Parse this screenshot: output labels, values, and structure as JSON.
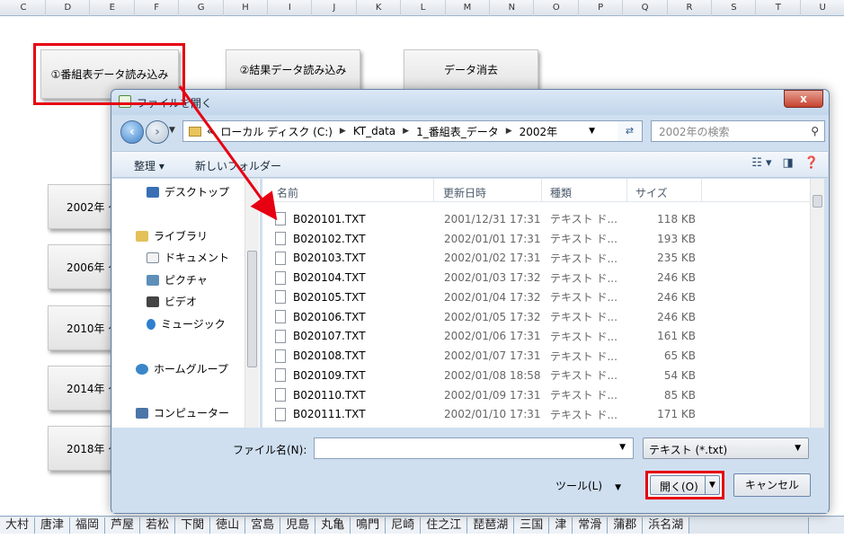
{
  "spreadsheet": {
    "columns": [
      "C",
      "D",
      "E",
      "F",
      "G",
      "H",
      "I",
      "J",
      "K",
      "L",
      "M",
      "N",
      "O",
      "P",
      "Q",
      "R",
      "S",
      "T",
      "U"
    ],
    "top_buttons": {
      "load_schedule": "①番組表データ読み込み",
      "load_results": "②結果データ読み込み",
      "clear_data": "データ消去"
    },
    "year_buttons": [
      "2002年 ～",
      "2006年 ～",
      "2010年 ～",
      "2014年 ～",
      "2018年 ～"
    ],
    "sheet_tabs": [
      "大村",
      "唐津",
      "福岡",
      "芦屋",
      "若松",
      "下関",
      "徳山",
      "宮島",
      "児島",
      "丸亀",
      "鳴門",
      "尼崎",
      "住之江",
      "琵琶湖",
      "三国",
      "津",
      "常滑",
      "蒲郡",
      "浜名湖"
    ]
  },
  "dialog": {
    "title": "ファイルを開く",
    "close_label": "x",
    "address": {
      "prefix": "«",
      "crumbs": [
        "ローカル ディスク (C:)",
        "KT_data",
        "1_番組表_データ",
        "2002年"
      ]
    },
    "search_placeholder": "2002年の検索",
    "toolbar": {
      "organize": "整理 ▾",
      "new_folder": "新しいフォルダー"
    },
    "nav": [
      "デスクトップ",
      "ライブラリ",
      "ドキュメント",
      "ピクチャ",
      "ビデオ",
      "ミュージック",
      "ホームグループ",
      "コンピューター"
    ],
    "columns": {
      "name": "名前",
      "date": "更新日時",
      "type": "種類",
      "size": "サイズ"
    },
    "files": [
      {
        "name": "B020101.TXT",
        "date": "2001/12/31 17:31",
        "type": "テキスト ド...",
        "size": "118 KB"
      },
      {
        "name": "B020102.TXT",
        "date": "2002/01/01 17:31",
        "type": "テキスト ド...",
        "size": "193 KB"
      },
      {
        "name": "B020103.TXT",
        "date": "2002/01/02 17:31",
        "type": "テキスト ド...",
        "size": "235 KB"
      },
      {
        "name": "B020104.TXT",
        "date": "2002/01/03 17:32",
        "type": "テキスト ド...",
        "size": "246 KB"
      },
      {
        "name": "B020105.TXT",
        "date": "2002/01/04 17:32",
        "type": "テキスト ド...",
        "size": "246 KB"
      },
      {
        "name": "B020106.TXT",
        "date": "2002/01/05 17:32",
        "type": "テキスト ド...",
        "size": "246 KB"
      },
      {
        "name": "B020107.TXT",
        "date": "2002/01/06 17:31",
        "type": "テキスト ド...",
        "size": "161 KB"
      },
      {
        "name": "B020108.TXT",
        "date": "2002/01/07 17:31",
        "type": "テキスト ド...",
        "size": "65 KB"
      },
      {
        "name": "B020109.TXT",
        "date": "2002/01/08 18:58",
        "type": "テキスト ド...",
        "size": "54 KB"
      },
      {
        "name": "B020110.TXT",
        "date": "2002/01/09 17:31",
        "type": "テキスト ド...",
        "size": "85 KB"
      },
      {
        "name": "B020111.TXT",
        "date": "2002/01/10 17:31",
        "type": "テキスト ド...",
        "size": "171 KB"
      }
    ],
    "filename_label": "ファイル名(N):",
    "filename_value": "",
    "filetype_value": "テキスト (*.txt)",
    "tools_label": "ツール(L)",
    "open_label": "開く(O)",
    "cancel_label": "キャンセル"
  },
  "colors": {
    "highlight": "#e60012",
    "dialog_bg": "#cfdff0"
  }
}
